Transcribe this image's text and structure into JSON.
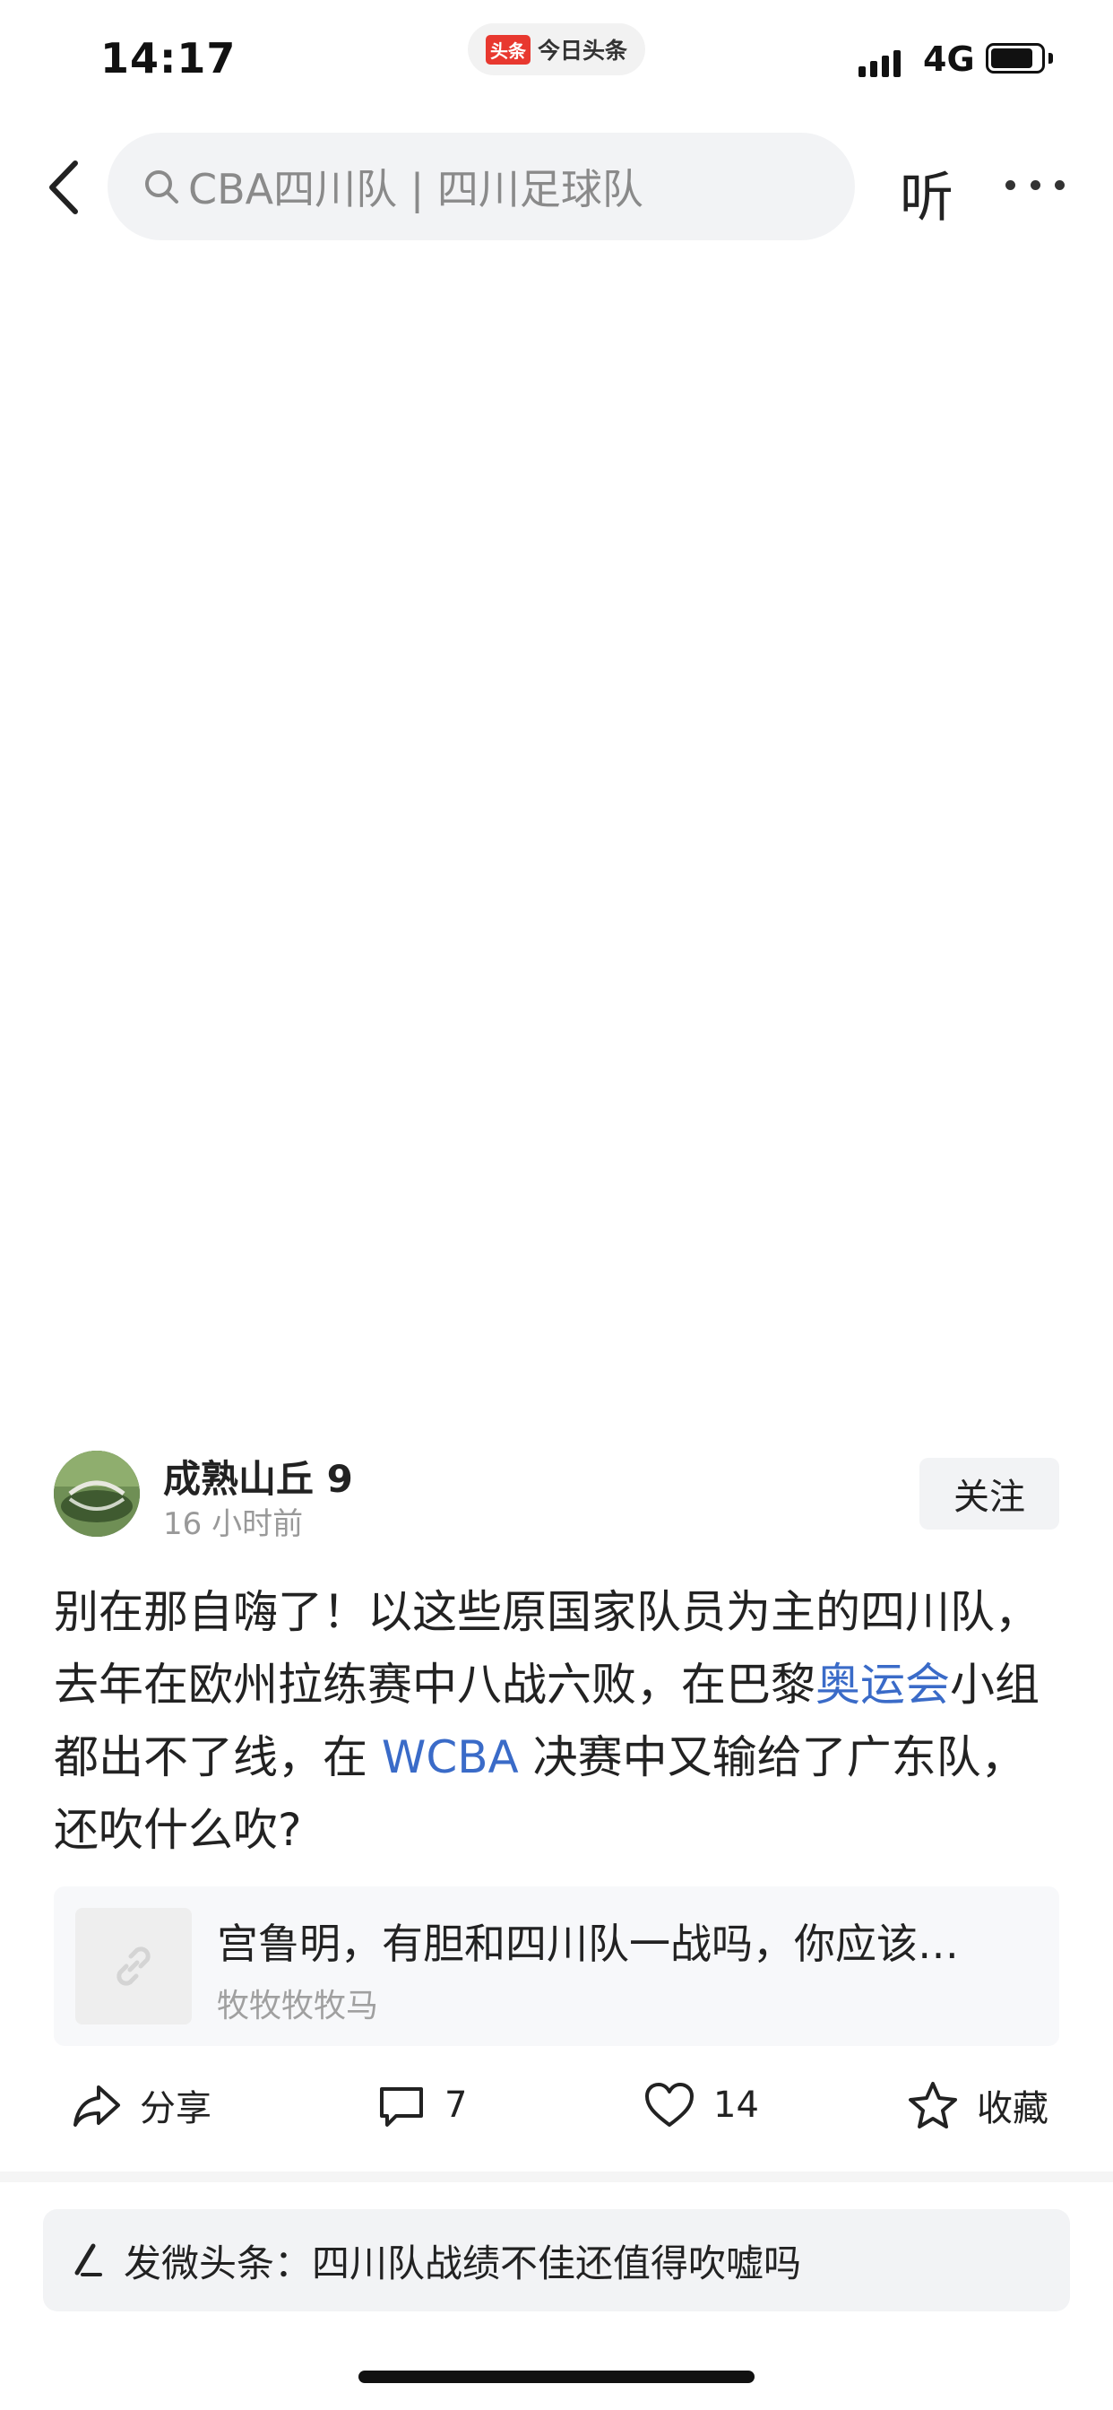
{
  "status_bar": {
    "time": "14:17",
    "app_logo": "头条",
    "app_name": "今日头条",
    "network": "4G",
    "battery_level": 0.85
  },
  "nav": {
    "search_placeholder": "CBA四川队 | 四川足球队",
    "listen_label": "听",
    "icons": {
      "back": "chevron-left-icon",
      "search": "search-icon",
      "more": "more-dots-icon"
    }
  },
  "post": {
    "author": "成熟山丘 9",
    "time": "16 小时前",
    "follow_label": "关注",
    "body_parts": {
      "p1": "别在那自嗨了！以这些原国家队员为主的四川队，去年在欧州拉练赛中八战六败，在巴黎",
      "link1": "奥运会",
      "p2": "小组都出不了线，在 ",
      "link2": "WCBA",
      "p3": " 决赛中又输给了广东队，还吹什么吹?"
    },
    "shared_card": {
      "title": "宫鲁明，有胆和四川队一战吗，你应该…",
      "source": "牧牧牧牧马",
      "icon": "link-icon"
    }
  },
  "actions": {
    "share_label": "分享",
    "comment_count": "7",
    "like_count": "14",
    "favorite_label": "收藏"
  },
  "compose": {
    "text": "发微头条：四川队战绩不佳还值得吹嘘吗"
  }
}
